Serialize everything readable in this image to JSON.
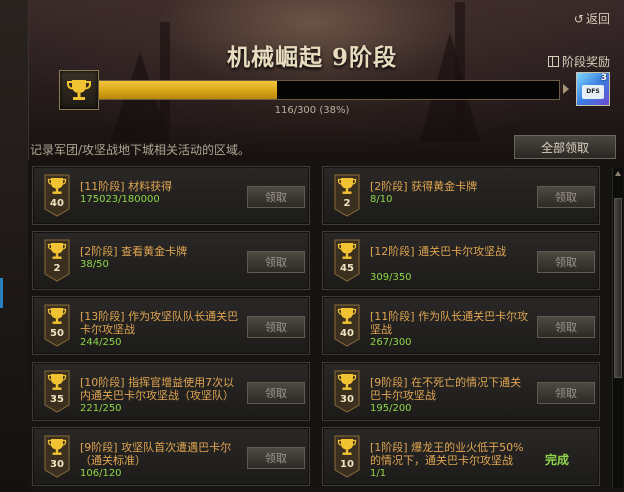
{
  "header": {
    "back_label": "返回",
    "title": "机械崛起 9阶段",
    "reward_label": "阶段奖励",
    "progress": {
      "current": 116,
      "total": 300,
      "percent": 38,
      "text": "116/300 (38%)"
    },
    "reward_card": {
      "count": "3",
      "label": "DFS"
    }
  },
  "description": "记录军团/攻坚战地下城相关活动的区域。",
  "claim_all_label": "全部领取",
  "colors": {
    "accent": "#e0a552",
    "progress_fill": "#d7a316",
    "count": "#8fd64a"
  },
  "items": [
    {
      "level": "40",
      "name": "[11阶段] 材料获得",
      "count": "175023/180000",
      "action": "领取",
      "done": false
    },
    {
      "level": "2",
      "name": "[2阶段] 获得黄金卡牌",
      "count": "8/10",
      "action": "领取",
      "done": false
    },
    {
      "level": "2",
      "name": "[2阶段] 查看黄金卡牌",
      "count": "38/50",
      "action": "领取",
      "done": false
    },
    {
      "level": "45",
      "name": "[12阶段] 通关巴卡尔攻坚战",
      "count": "309/350",
      "action": "领取",
      "done": false
    },
    {
      "level": "50",
      "name": "[13阶段] 作为攻坚队队长通关巴卡尔攻坚战",
      "count": "244/250",
      "action": "领取",
      "done": false
    },
    {
      "level": "40",
      "name": "[11阶段] 作为队长通关巴卡尔攻坚战",
      "count": "267/300",
      "action": "领取",
      "done": false
    },
    {
      "level": "35",
      "name": "[10阶段] 指挥官增益使用7次以内通关巴卡尔攻坚战（攻坚队）",
      "count": "221/250",
      "action": "领取",
      "done": false
    },
    {
      "level": "30",
      "name": "[9阶段] 在不死亡的情况下通关巴卡尔攻坚战",
      "count": "195/200",
      "action": "领取",
      "done": false
    },
    {
      "level": "30",
      "name": "[9阶段] 攻坚队首次遭遇巴卡尔（通关标准）",
      "count": "106/120",
      "action": "领取",
      "done": false
    },
    {
      "level": "10",
      "name": "[1阶段] 爆龙王的业火低于50%的情况下，通关巴卡尔攻坚战",
      "count": "1/1",
      "action": "完成",
      "done": true
    }
  ]
}
